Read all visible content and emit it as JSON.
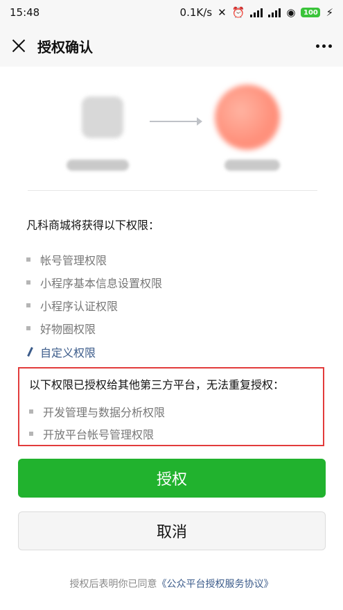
{
  "status": {
    "time": "15:48",
    "net_speed": "0.1K/s",
    "battery": "100"
  },
  "header": {
    "title": "授权确认"
  },
  "hero": {
    "left_app_name": "",
    "right_app_name": ""
  },
  "permissions": {
    "title": "凡科商城将获得以下权限：",
    "items": [
      {
        "label": "帐号管理权限"
      },
      {
        "label": "小程序基本信息设置权限"
      },
      {
        "label": "小程序认证权限"
      },
      {
        "label": "好物圈权限"
      }
    ],
    "custom_label": "自定义权限"
  },
  "already_authorized": {
    "title": "以下权限已授权给其他第三方平台，无法重复授权：",
    "items": [
      {
        "label": "开发管理与数据分析权限"
      },
      {
        "label": "开放平台帐号管理权限"
      }
    ]
  },
  "actions": {
    "authorize_label": "授权",
    "cancel_label": "取消"
  },
  "footer": {
    "text": "授权后表明你已同意",
    "link": "《公众平台授权服务协议》"
  },
  "colors": {
    "accent_green": "#21b22e",
    "link_blue": "#3b5b8a",
    "warning_red": "#e23b3b"
  }
}
